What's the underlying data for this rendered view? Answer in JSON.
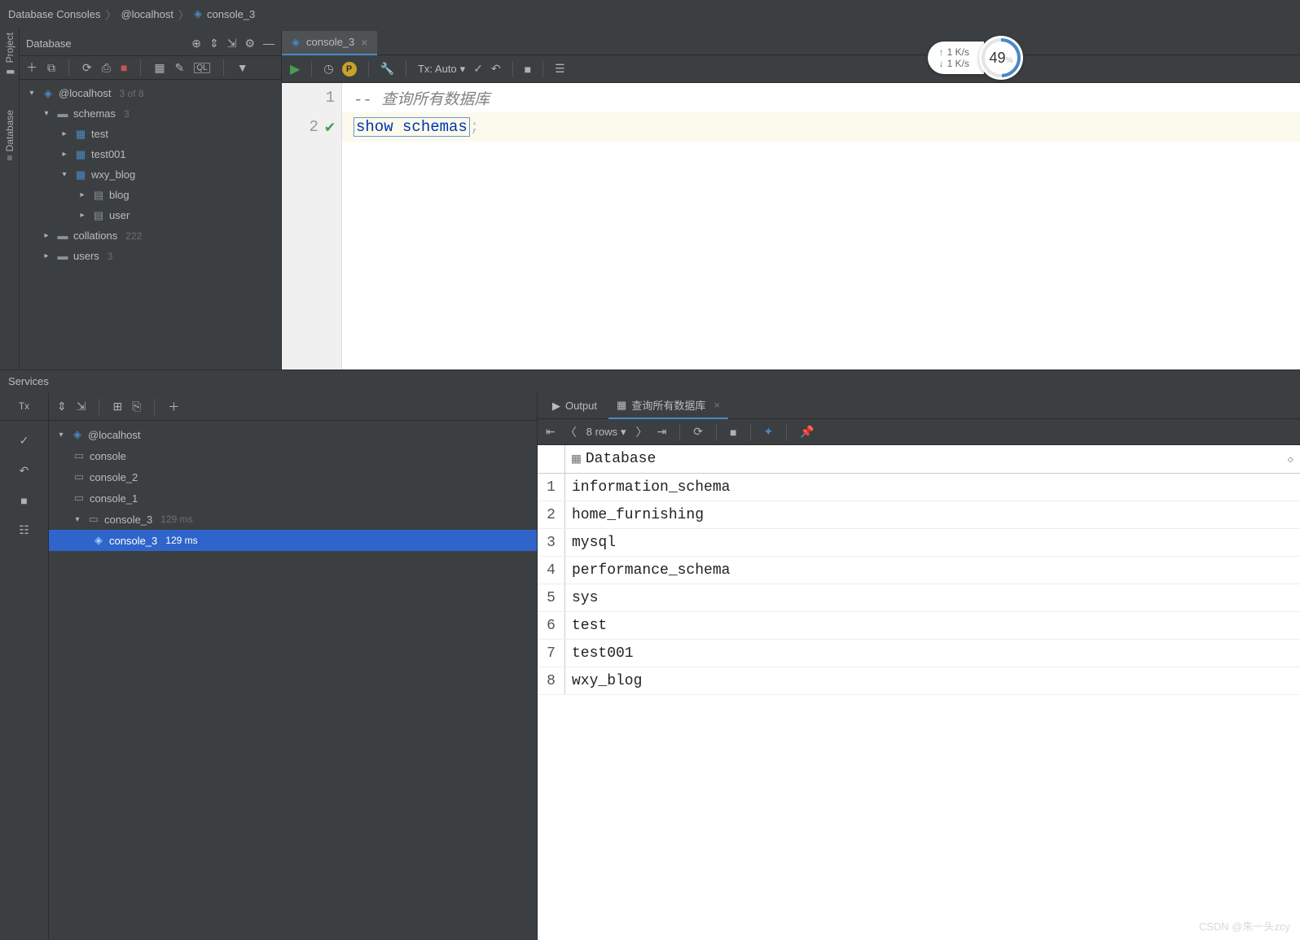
{
  "breadcrumb": {
    "a": "Database Consoles",
    "b": "@localhost",
    "c": "console_3"
  },
  "sidetabs": {
    "project": "Project",
    "database": "Database"
  },
  "dbpanel": {
    "title": "Database",
    "tree": {
      "host": "@localhost",
      "host_hint": "3 of 8",
      "schemas": "schemas",
      "schemas_hint": "3",
      "test": "test",
      "test001": "test001",
      "wxy_blog": "wxy_blog",
      "blog": "blog",
      "user": "user",
      "collations": "collations",
      "collations_hint": "222",
      "users": "users",
      "users_hint": "3"
    }
  },
  "editor": {
    "tab": "console_3",
    "tx": "Tx: Auto",
    "line1": "--  查询所有数据库",
    "kw1": "show",
    "kw2": "schemas",
    "semi": " ;"
  },
  "net": {
    "up": "1  K/s",
    "down": "1  K/s",
    "pct": "49",
    "pctunit": "%"
  },
  "services": {
    "title": "Services",
    "tx": "Tx",
    "host": "@localhost",
    "console": "console",
    "console_2": "console_2",
    "console_1": "console_1",
    "console_3": "console_3",
    "ms": "129 ms",
    "output": "Output",
    "qtab": "查询所有数据库",
    "rows": "8 rows",
    "colname": "Database",
    "data": [
      "information_schema",
      "home_furnishing",
      "mysql",
      "performance_schema",
      "sys",
      "test",
      "test001",
      "wxy_blog"
    ]
  },
  "watermark": "CSDN @朱一头zcy"
}
